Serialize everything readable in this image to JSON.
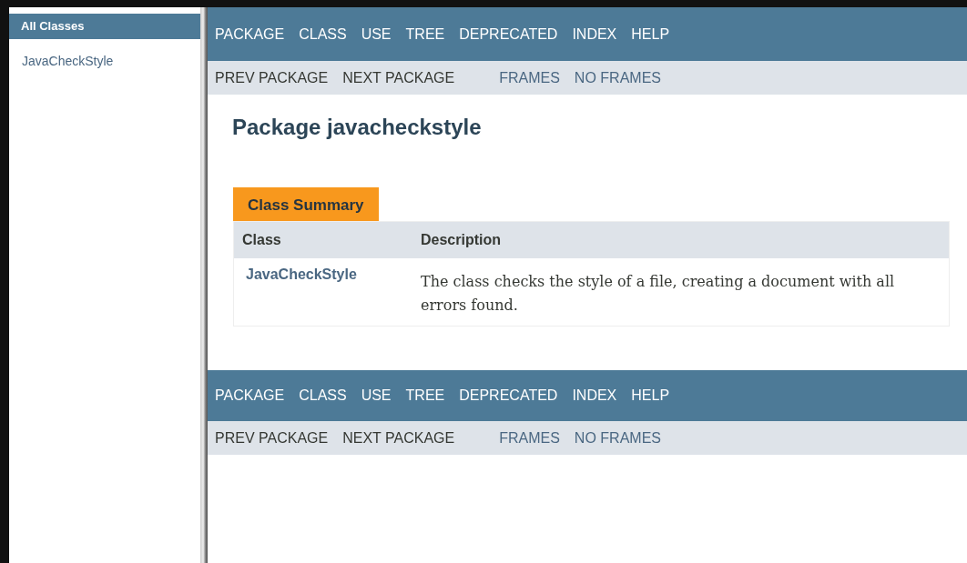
{
  "all_classes_frame": {
    "title": "All Classes",
    "items": [
      "JavaCheckStyle"
    ]
  },
  "top_nav": {
    "items": [
      "PACKAGE",
      "CLASS",
      "USE",
      "TREE",
      "DEPRECATED",
      "INDEX",
      "HELP"
    ],
    "subnav": [
      {
        "label": "PREV PACKAGE",
        "kind": "text"
      },
      {
        "label": "NEXT PACKAGE",
        "kind": "text"
      },
      {
        "label": "FRAMES",
        "kind": "link"
      },
      {
        "label": "NO FRAMES",
        "kind": "link"
      }
    ]
  },
  "page_title": "Package javacheckstyle",
  "class_summary": {
    "caption": "Class Summary",
    "columns": [
      "Class",
      "Description"
    ],
    "rows": [
      {
        "class": "JavaCheckStyle",
        "description": "The class checks the style of a file, creating a document with all errors found."
      }
    ]
  },
  "bottom_nav": {
    "items": [
      "PACKAGE",
      "CLASS",
      "USE",
      "TREE",
      "DEPRECATED",
      "INDEX",
      "HELP"
    ],
    "subnav": [
      {
        "label": "PREV PACKAGE",
        "kind": "text"
      },
      {
        "label": "NEXT PACKAGE",
        "kind": "text"
      },
      {
        "label": "FRAMES",
        "kind": "link"
      },
      {
        "label": "NO FRAMES",
        "kind": "link"
      }
    ]
  }
}
